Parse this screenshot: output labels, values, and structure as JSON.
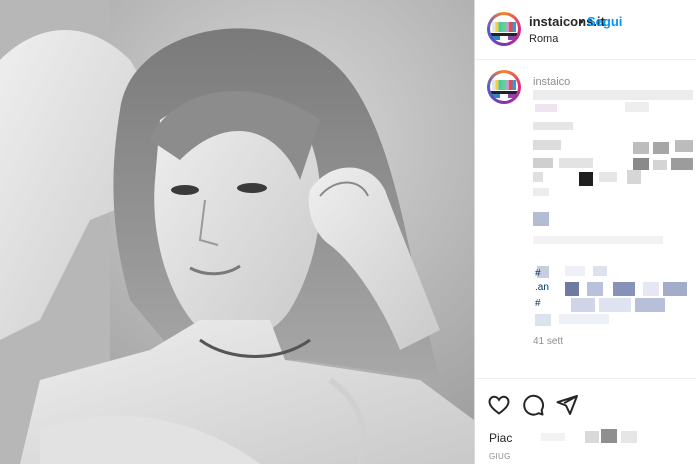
{
  "post": {
    "username": "instaicons.it",
    "separator": "•",
    "follow_label": "Segui",
    "location": "Roma",
    "caption_visible": "instaico",
    "tags_visible": [
      "#",
      ".an",
      "#"
    ],
    "time_ago": "41 sett",
    "likes_prefix": "Piac",
    "date_prefix": "GIUG"
  },
  "icons": {
    "like": "heart-icon",
    "comment": "comment-icon",
    "share": "send-icon"
  },
  "colors": {
    "accent": "#0095f6",
    "text": "#262626",
    "muted": "#8e8e8e"
  }
}
